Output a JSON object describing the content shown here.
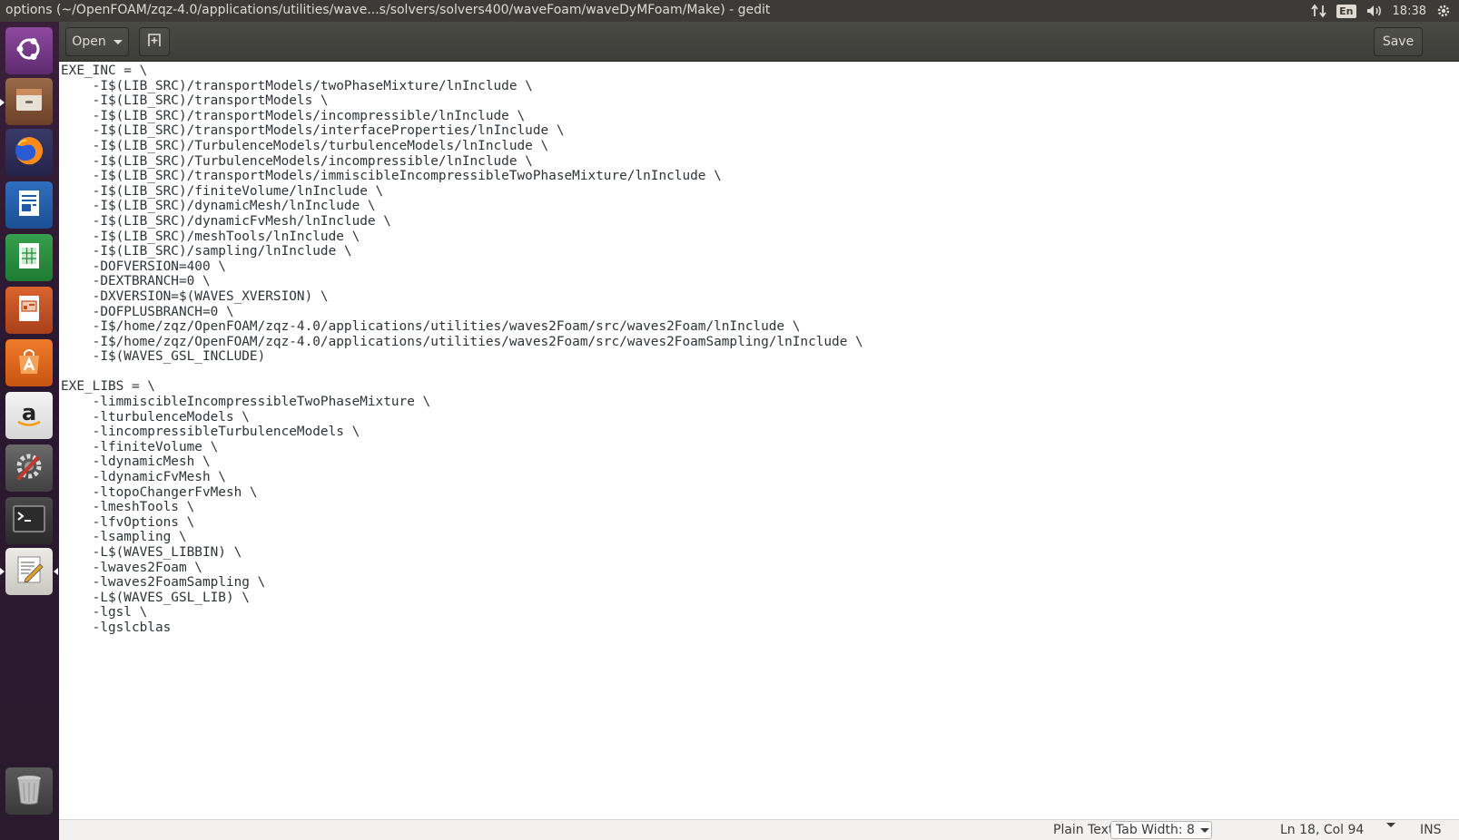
{
  "window": {
    "title": "options (~/OpenFOAM/zqz-4.0/applications/utilities/wave...s/solvers/solvers400/waveFoam/waveDyMFoam/Make) - gedit"
  },
  "top_panel": {
    "keyboard_lang": "En",
    "clock": "18:38"
  },
  "launcher": {
    "items": [
      {
        "name": "ubuntu-dash",
        "icon": "ubuntu-logo-icon",
        "color": "#7a3e8a"
      },
      {
        "name": "files",
        "icon": "file-cabinet-icon",
        "color": "#8b5a3c"
      },
      {
        "name": "firefox",
        "icon": "firefox-icon",
        "color": "#e66000"
      },
      {
        "name": "libreoffice-writer",
        "icon": "writer-document-icon",
        "color": "#1d5aa8"
      },
      {
        "name": "libreoffice-calc",
        "icon": "calc-spreadsheet-icon",
        "color": "#1f8a3a"
      },
      {
        "name": "libreoffice-impress",
        "icon": "impress-presentation-icon",
        "color": "#c24b1c"
      },
      {
        "name": "software-center",
        "icon": "shopping-bag-icon",
        "color": "#e3661d"
      },
      {
        "name": "amazon",
        "icon": "amazon-icon",
        "color": "#e8e8e8"
      },
      {
        "name": "system-settings",
        "icon": "settings-wrench-icon",
        "color": "#5a5a5a"
      },
      {
        "name": "terminal",
        "icon": "terminal-icon",
        "color": "#2e2e2e"
      },
      {
        "name": "text-editor",
        "icon": "text-editor-icon",
        "color": "#e8e6e0"
      },
      {
        "name": "trash",
        "icon": "trash-icon",
        "color": "#5a5a5a"
      }
    ]
  },
  "toolbar": {
    "open_label": "Open",
    "save_label": "Save"
  },
  "document": {
    "lines": [
      "EXE_INC = \\",
      "    -I$(LIB_SRC)/transportModels/twoPhaseMixture/lnInclude \\",
      "    -I$(LIB_SRC)/transportModels \\",
      "    -I$(LIB_SRC)/transportModels/incompressible/lnInclude \\",
      "    -I$(LIB_SRC)/transportModels/interfaceProperties/lnInclude \\",
      "    -I$(LIB_SRC)/TurbulenceModels/turbulenceModels/lnInclude \\",
      "    -I$(LIB_SRC)/TurbulenceModels/incompressible/lnInclude \\",
      "    -I$(LIB_SRC)/transportModels/immiscibleIncompressibleTwoPhaseMixture/lnInclude \\",
      "    -I$(LIB_SRC)/finiteVolume/lnInclude \\",
      "    -I$(LIB_SRC)/dynamicMesh/lnInclude \\",
      "    -I$(LIB_SRC)/dynamicFvMesh/lnInclude \\",
      "    -I$(LIB_SRC)/meshTools/lnInclude \\",
      "    -I$(LIB_SRC)/sampling/lnInclude \\",
      "    -DOFVERSION=400 \\",
      "    -DEXTBRANCH=0 \\",
      "    -DXVERSION=$(WAVES_XVERSION) \\",
      "    -DOFPLUSBRANCH=0 \\",
      "    -I$/home/zqz/OpenFOAM/zqz-4.0/applications/utilities/waves2Foam/src/waves2Foam/lnInclude \\",
      "    -I$/home/zqz/OpenFOAM/zqz-4.0/applications/utilities/waves2Foam/src/waves2FoamSampling/lnInclude \\",
      "    -I$(WAVES_GSL_INCLUDE)",
      "",
      "EXE_LIBS = \\",
      "    -limmiscibleIncompressibleTwoPhaseMixture \\",
      "    -lturbulenceModels \\",
      "    -lincompressibleTurbulenceModels \\",
      "    -lfiniteVolume \\",
      "    -ldynamicMesh \\",
      "    -ldynamicFvMesh \\",
      "    -ltopoChangerFvMesh \\",
      "    -lmeshTools \\",
      "    -lfvOptions \\",
      "    -lsampling \\",
      "    -L$(WAVES_LIBBIN) \\",
      "    -lwaves2Foam \\",
      "    -lwaves2FoamSampling \\",
      "    -L$(WAVES_GSL_LIB) \\",
      "    -lgsl \\",
      "    -lgslcblas"
    ]
  },
  "statusbar": {
    "language": "Plain Text",
    "tab_width": "Tab Width: 8",
    "position": "Ln 18, Col 94",
    "mode": "INS"
  }
}
